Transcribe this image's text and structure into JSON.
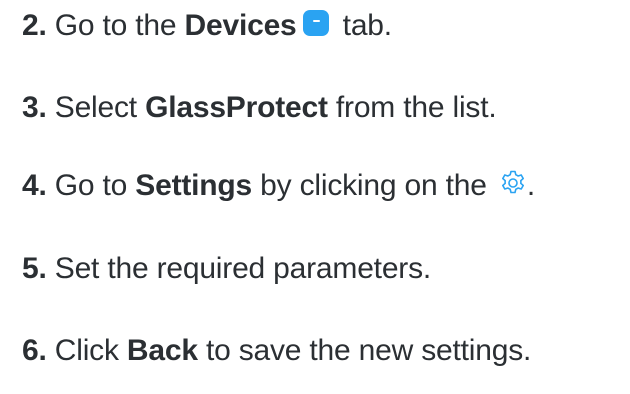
{
  "steps": [
    {
      "num": "2.",
      "pre": " Go to the ",
      "bold": "Devices",
      "post": " tab."
    },
    {
      "num": "3.",
      "pre": " Select ",
      "bold": "GlassProtect",
      "post": " from the list."
    },
    {
      "num": "4.",
      "pre": " Go to ",
      "bold": "Settings",
      "post": " by clicking on the ",
      "end": "."
    },
    {
      "num": "5.",
      "pre": " Set the required parameters.",
      "bold": "",
      "post": ""
    },
    {
      "num": "6.",
      "pre": " Click ",
      "bold": "Back",
      "post": " to save the new settings."
    }
  ],
  "icons": {
    "devices_tab": "devices-tab-icon",
    "settings": "gear-icon"
  },
  "colors": {
    "text": "#2b2f33",
    "accent": "#2aa3f2"
  }
}
